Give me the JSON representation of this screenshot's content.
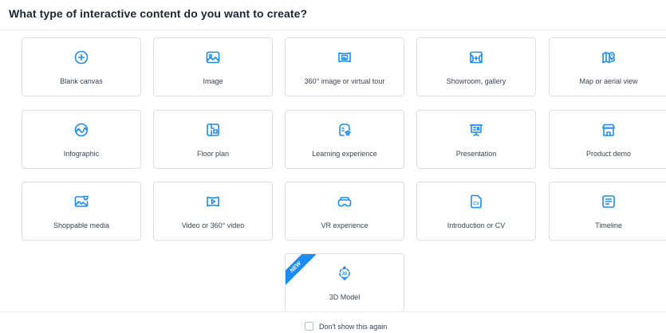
{
  "dialog": {
    "title": "What type of interactive content do you want to create?"
  },
  "accent_color": "#1d8cf0",
  "options": [
    {
      "label": "Blank canvas",
      "icon": "plus-circle-icon"
    },
    {
      "label": "Image",
      "icon": "image-icon"
    },
    {
      "label": "360° image or virtual tour",
      "icon": "panorama-icon"
    },
    {
      "label": "Showroom, gallery",
      "icon": "showroom-icon"
    },
    {
      "label": "Map or aerial view",
      "icon": "map-pin-icon"
    },
    {
      "label": "Infographic",
      "icon": "infographic-icon"
    },
    {
      "label": "Floor plan",
      "icon": "floor-plan-icon"
    },
    {
      "label": "Learning experience",
      "icon": "learning-icon"
    },
    {
      "label": "Presentation",
      "icon": "presentation-icon"
    },
    {
      "label": "Product demo",
      "icon": "store-icon"
    },
    {
      "label": "Shoppable media",
      "icon": "shoppable-media-icon"
    },
    {
      "label": "Video or 360° video",
      "icon": "video-icon"
    },
    {
      "label": "VR experience",
      "icon": "vr-headset-icon"
    },
    {
      "label": "Introduction or CV",
      "icon": "cv-document-icon"
    },
    {
      "label": "Timeline",
      "icon": "timeline-icon"
    },
    {
      "label": "3D Model",
      "icon": "3d-model-icon",
      "badge": "NEW"
    }
  ],
  "footer": {
    "dont_show_label": "Don't show this again",
    "dont_show_checked": false
  }
}
